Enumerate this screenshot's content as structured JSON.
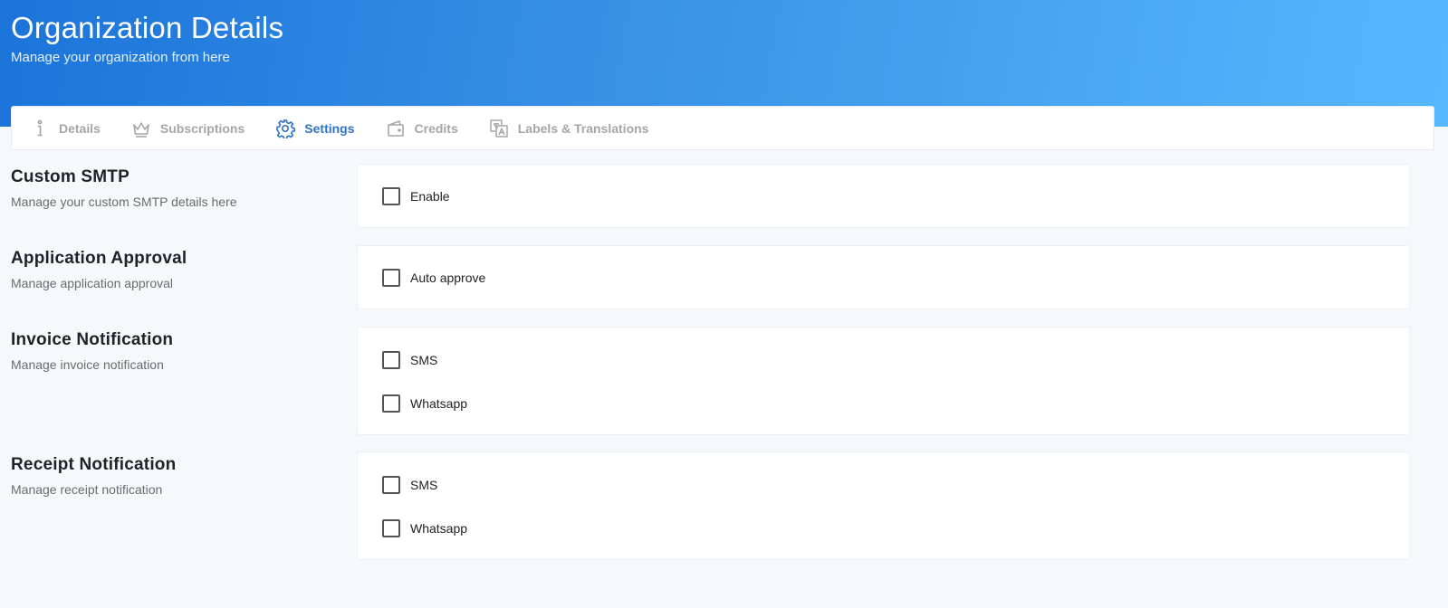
{
  "header": {
    "title": "Organization Details",
    "subtitle": "Manage your organization from here"
  },
  "tabs": [
    {
      "label": "Details",
      "icon": "info-icon",
      "active": false
    },
    {
      "label": "Subscriptions",
      "icon": "crown-icon",
      "active": false
    },
    {
      "label": "Settings",
      "icon": "gear-icon",
      "active": true
    },
    {
      "label": "Credits",
      "icon": "wallet-icon",
      "active": false
    },
    {
      "label": "Labels & Translations",
      "icon": "translate-icon",
      "active": false
    }
  ],
  "sections": {
    "smtp": {
      "title": "Custom SMTP",
      "desc": "Manage your custom SMTP details here",
      "options": [
        {
          "label": "Enable",
          "checked": false
        }
      ]
    },
    "approval": {
      "title": "Application Approval",
      "desc": "Manage application approval",
      "options": [
        {
          "label": "Auto approve",
          "checked": false
        }
      ]
    },
    "invoice": {
      "title": "Invoice Notification",
      "desc": "Manage invoice notification",
      "options": [
        {
          "label": "SMS",
          "checked": false
        },
        {
          "label": "Whatsapp",
          "checked": false
        }
      ]
    },
    "receipt": {
      "title": "Receipt Notification",
      "desc": "Manage receipt notification",
      "options": [
        {
          "label": "SMS",
          "checked": false
        },
        {
          "label": "Whatsapp",
          "checked": false
        }
      ]
    }
  },
  "colors": {
    "accent": "#2f74c9",
    "header_gradient_start": "#1b74d9",
    "header_gradient_end": "#56b8ff",
    "tab_inactive": "#a6a6a6"
  }
}
